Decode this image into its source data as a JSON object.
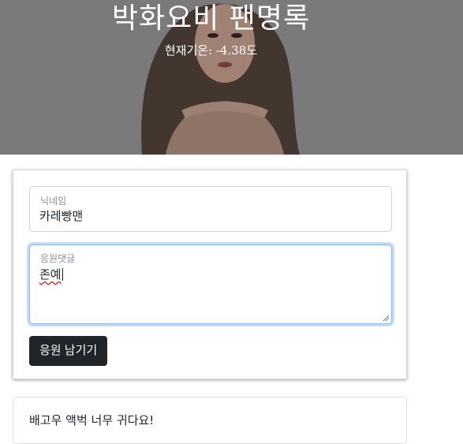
{
  "header": {
    "title": "박화요비 팬명록",
    "temperature": "현재기온: -4.38도"
  },
  "form": {
    "nickname": {
      "label": "닉네임",
      "value": "카레빵맨"
    },
    "comment": {
      "label": "응원댓글",
      "value": "존예"
    },
    "submit_label": "응원 남기기"
  },
  "comments": [
    {
      "text": "배고우 액벅 너무 귀다요!"
    }
  ],
  "colors": {
    "hero_overlay": "#7a7a7a",
    "button": "#212529",
    "focus_border": "#86b7fe"
  }
}
